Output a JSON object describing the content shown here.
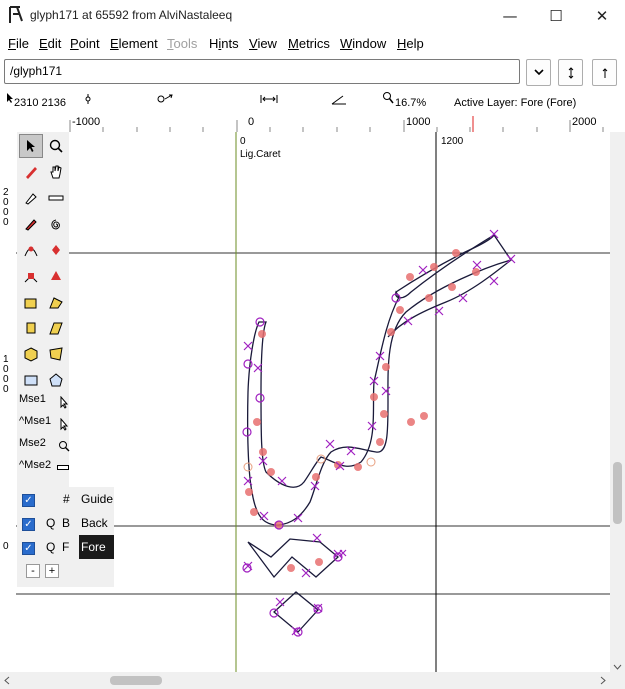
{
  "window": {
    "title": "glyph171 at 65592 from AlviNastaleeq",
    "minimize_glyph": "—",
    "maximize_glyph": "☐",
    "close_glyph": "✕"
  },
  "menu": {
    "items": [
      {
        "label": "File",
        "u": "F",
        "rest": "ile",
        "enabled": true
      },
      {
        "label": "Edit",
        "u": "E",
        "rest": "dit",
        "enabled": true
      },
      {
        "label": "Point",
        "u": "P",
        "rest": "oint",
        "enabled": true
      },
      {
        "label": "Element",
        "u": "E",
        "rest": "lement",
        "enabled": true
      },
      {
        "label": "Tools",
        "u": "T",
        "rest": "ools",
        "enabled": false
      },
      {
        "label": "Hints",
        "u": "i",
        "rest": "nts",
        "prefix": "H",
        "enabled": true
      },
      {
        "label": "View",
        "u": "V",
        "rest": "iew",
        "enabled": true
      },
      {
        "label": "Metrics",
        "u": "M",
        "rest": "etrics",
        "enabled": true
      },
      {
        "label": "Window",
        "u": "W",
        "rest": "indow",
        "enabled": true
      },
      {
        "label": "Help",
        "u": "H",
        "rest": "elp",
        "enabled": true
      }
    ]
  },
  "glyph_field": {
    "value": "/glyph171"
  },
  "status": {
    "coords": "2310 2136",
    "zoom": "16.7%",
    "active_layer": "Active Layer: Fore (Fore)"
  },
  "ruler": {
    "top_ticks": [
      "-1000",
      "0",
      "1000",
      "2000"
    ],
    "left_ticks": [
      "2",
      "0",
      "0",
      "0",
      "1",
      "0",
      "0",
      "0",
      "0"
    ]
  },
  "canvas": {
    "origin_label": "0",
    "caret_label": "Lig.Caret",
    "width_label": "1200"
  },
  "tools": {
    "mse1": "Mse1",
    "cmse1": "^Mse1",
    "mse2": "Mse2",
    "cmse2": "^Mse2"
  },
  "layers": [
    {
      "q": "",
      "b": "#",
      "name": "Guide",
      "checked": true
    },
    {
      "q": "Q",
      "b": "B",
      "name": "Back",
      "checked": true
    },
    {
      "q": "Q",
      "b": "F",
      "name": "Fore",
      "checked": true,
      "active": true
    }
  ],
  "layer_buttons": {
    "minus": "-",
    "plus": "+"
  },
  "colors": {
    "accent": "#2a6ccc",
    "point_on": "#e87070",
    "point_cp": "#a020c0",
    "guide": "#000000",
    "baseline_green": "#6b8e23"
  }
}
